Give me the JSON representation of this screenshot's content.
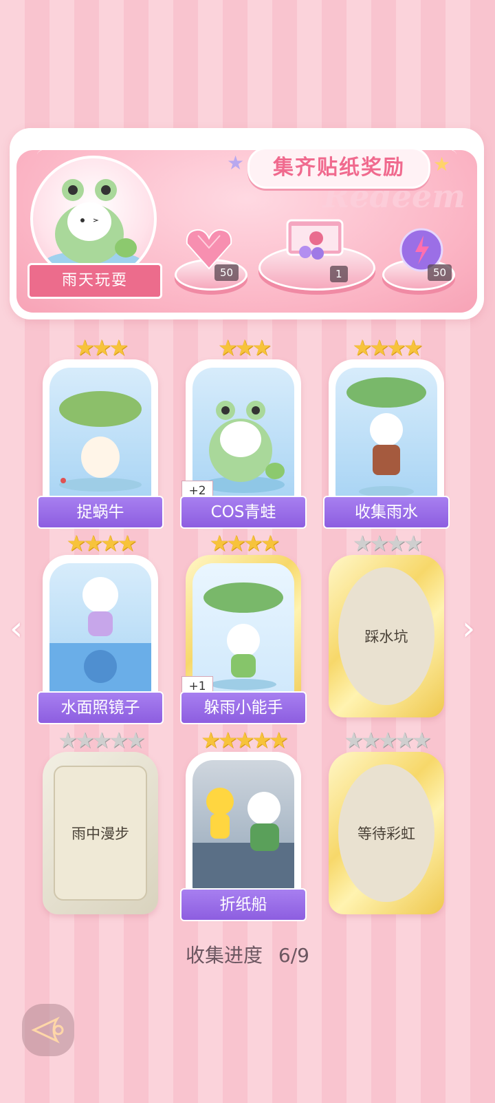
{
  "banner": {
    "title": "集齐贴纸奖励",
    "watermark": "Redeem",
    "theme_name": "雨天玩耍",
    "rewards": [
      {
        "icon": "pink-diamond-heart-icon",
        "count": "50"
      },
      {
        "icon": "gift-box-icon",
        "count": "1"
      },
      {
        "icon": "energy-orb-icon",
        "count": "50"
      }
    ]
  },
  "stickers": [
    {
      "name": "捉蜗牛",
      "stars": 3,
      "stars_gold": 3,
      "locked": false,
      "frame": "blue",
      "extra": ""
    },
    {
      "name": "COS青蛙",
      "stars": 3,
      "stars_gold": 3,
      "locked": false,
      "frame": "blue",
      "extra": "+2"
    },
    {
      "name": "收集雨水",
      "stars": 4,
      "stars_gold": 4,
      "locked": false,
      "frame": "blue",
      "extra": ""
    },
    {
      "name": "水面照镜子",
      "stars": 4,
      "stars_gold": 4,
      "locked": false,
      "frame": "blue",
      "extra": ""
    },
    {
      "name": "躲雨小能手",
      "stars": 4,
      "stars_gold": 4,
      "locked": false,
      "frame": "gold",
      "extra": "+1"
    },
    {
      "name": "踩水坑",
      "stars": 4,
      "stars_gold": 0,
      "locked": true,
      "frame": "gold",
      "extra": ""
    },
    {
      "name": "雨中漫步",
      "stars": 5,
      "stars_gold": 0,
      "locked": true,
      "frame": "silver",
      "extra": ""
    },
    {
      "name": "折纸船",
      "stars": 5,
      "stars_gold": 5,
      "locked": false,
      "frame": "blue",
      "extra": ""
    },
    {
      "name": "等待彩虹",
      "stars": 5,
      "stars_gold": 0,
      "locked": true,
      "frame": "gold",
      "extra": ""
    }
  ],
  "progress": {
    "label": "收集进度",
    "value": "6/9"
  },
  "nav": {
    "prev_icon": "chevron-left-icon",
    "next_icon": "chevron-right-icon",
    "back_icon": "back-icon"
  },
  "colors": {
    "accent": "#f06a8e",
    "label_purple": "#8d5ee0",
    "star_gold": "#f7c33b"
  }
}
